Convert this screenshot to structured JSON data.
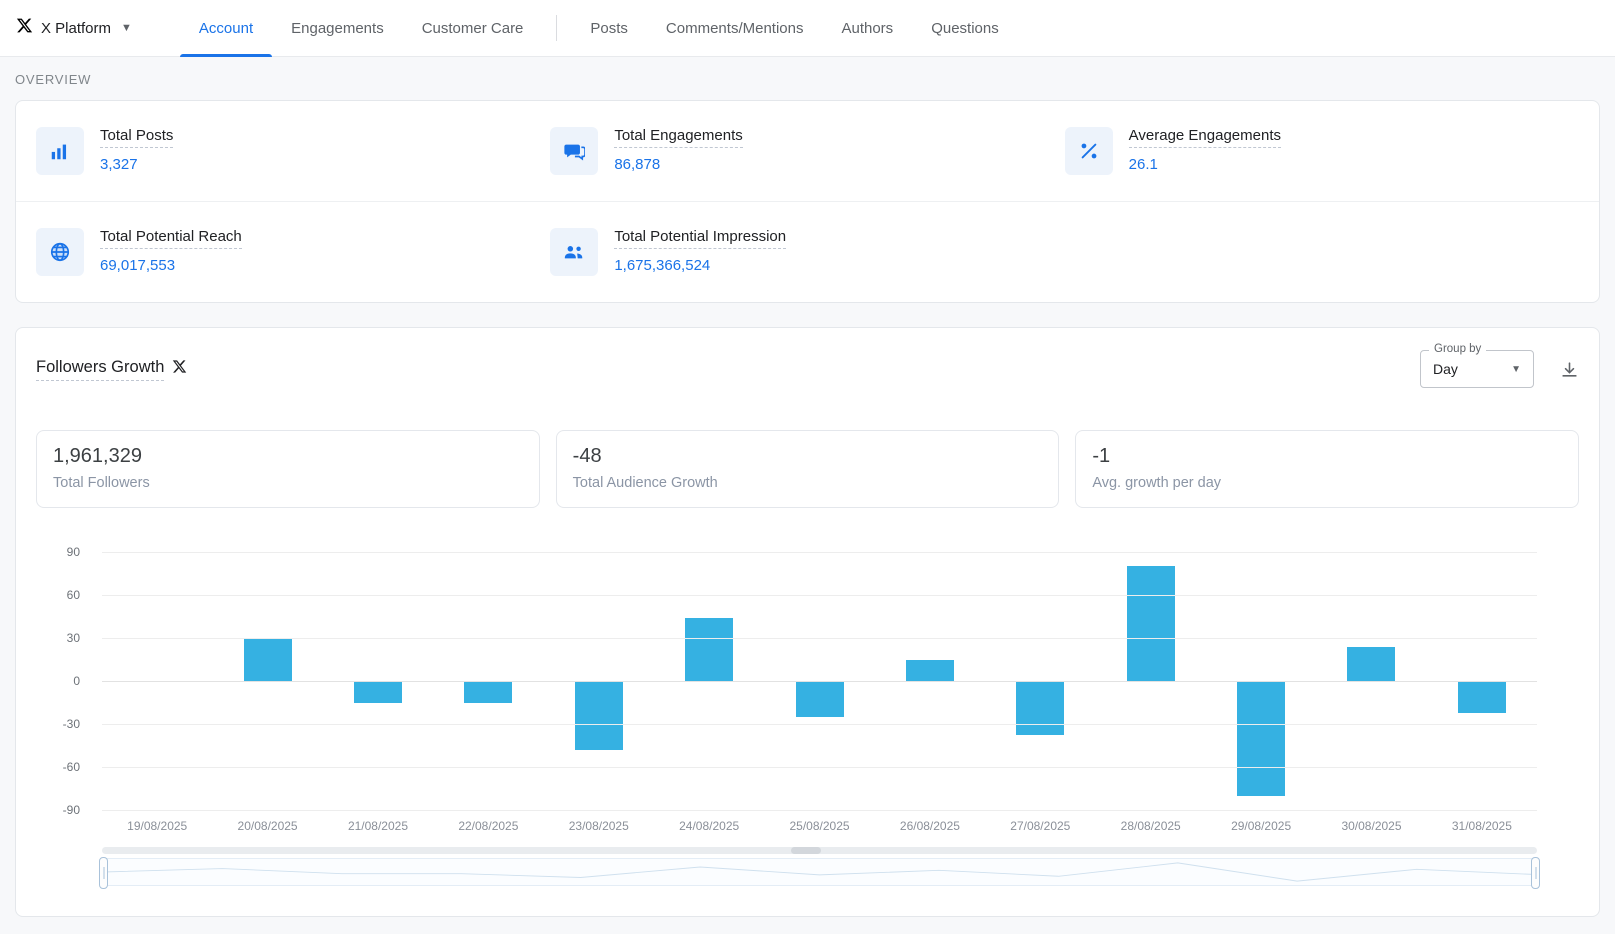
{
  "brand": {
    "name": "X Platform"
  },
  "nav": {
    "tabs": [
      {
        "label": "Account"
      },
      {
        "label": "Engagements"
      },
      {
        "label": "Customer Care"
      },
      {
        "label": "Posts"
      },
      {
        "label": "Comments/Mentions"
      },
      {
        "label": "Authors"
      },
      {
        "label": "Questions"
      }
    ],
    "active_tab": "Account"
  },
  "overview": {
    "section_label": "OVERVIEW",
    "metrics": [
      {
        "icon": "bar-chart-icon",
        "label": "Total Posts",
        "value": "3,327"
      },
      {
        "icon": "chat-bubbles-icon",
        "label": "Total Engagements",
        "value": "86,878"
      },
      {
        "icon": "percent-icon",
        "label": "Average Engagements",
        "value": "26.1"
      },
      {
        "icon": "globe-icon",
        "label": "Total Potential Reach",
        "value": "69,017,553"
      },
      {
        "icon": "people-icon",
        "label": "Total Potential Impression",
        "value": "1,675,366,524"
      }
    ]
  },
  "followers": {
    "title": "Followers Growth",
    "group_by_label": "Group by",
    "group_by_value": "Day",
    "stats": [
      {
        "value": "1,961,329",
        "label": "Total Followers"
      },
      {
        "value": "-48",
        "label": "Total Audience Growth"
      },
      {
        "value": "-1",
        "label": "Avg. growth per day"
      }
    ]
  },
  "chart_data": {
    "type": "bar",
    "title": "Followers Growth",
    "xlabel": "",
    "ylabel": "",
    "categories": [
      "19/08/2025",
      "20/08/2025",
      "21/08/2025",
      "22/08/2025",
      "23/08/2025",
      "24/08/2025",
      "25/08/2025",
      "26/08/2025",
      "27/08/2025",
      "28/08/2025",
      "29/08/2025",
      "30/08/2025",
      "31/08/2025"
    ],
    "values": [
      0,
      30,
      -15,
      -15,
      -48,
      44,
      -25,
      15,
      -38,
      80,
      -80,
      24,
      -22
    ],
    "ylim": [
      -90,
      90
    ],
    "yticks": [
      90,
      60,
      30,
      0,
      -30,
      -60,
      -90
    ],
    "bar_color": "#35b1e2",
    "grid": true,
    "legend": false
  },
  "colors": {
    "accent": "#1a73e8",
    "bar": "#35b1e2"
  }
}
